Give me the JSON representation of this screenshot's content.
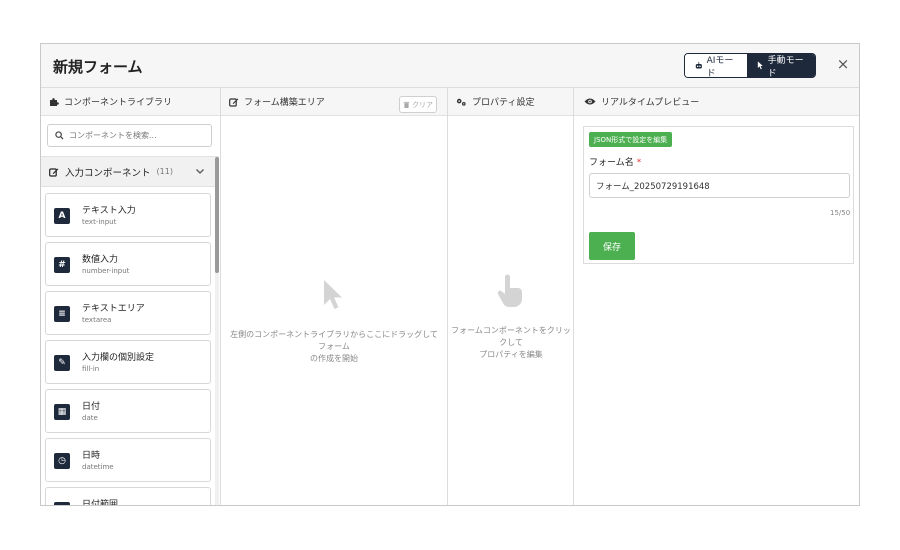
{
  "header": {
    "title": "新規フォーム",
    "ai_mode_label": "AIモード",
    "manual_mode_label": "手動モード",
    "close_label": "×"
  },
  "library": {
    "title": "コンポーネントライブラリ",
    "search_placeholder": "コンポーネントを検索...",
    "category": {
      "label": "入力コンポーネント",
      "count": "(11)"
    },
    "items": [
      {
        "label": "テキスト入力",
        "type": "text-input",
        "icon": "A"
      },
      {
        "label": "数値入力",
        "type": "number-input",
        "icon": "#"
      },
      {
        "label": "テキストエリア",
        "type": "textarea",
        "icon": "≡"
      },
      {
        "label": "入力欄の個別設定",
        "type": "fill-in",
        "icon": "✎"
      },
      {
        "label": "日付",
        "type": "date",
        "icon": "▦"
      },
      {
        "label": "日時",
        "type": "datetime",
        "icon": "◷"
      },
      {
        "label": "日付範囲",
        "type": "",
        "icon": "▦"
      }
    ]
  },
  "builder": {
    "title": "フォーム構築エリア",
    "clear_label": "クリア",
    "empty_line1": "左側のコンポーネントライブラリからここにドラッグしてフォーム",
    "empty_line2": "の作成を開始"
  },
  "properties": {
    "title": "プロパティ設定",
    "empty_line1": "フォームコンポーネントをクリックして",
    "empty_line2": "プロパティを編集"
  },
  "preview": {
    "title": "リアルタイムプレビュー",
    "json_button": "JSON形式で設定を編集",
    "field_label": "フォーム名",
    "required_mark": "*",
    "field_value": "フォーム_20250729191648",
    "char_count": "15/50",
    "save_label": "保存"
  },
  "colors": {
    "accent_dark": "#1e293b",
    "success": "#4caf50",
    "required": "#e53935"
  }
}
